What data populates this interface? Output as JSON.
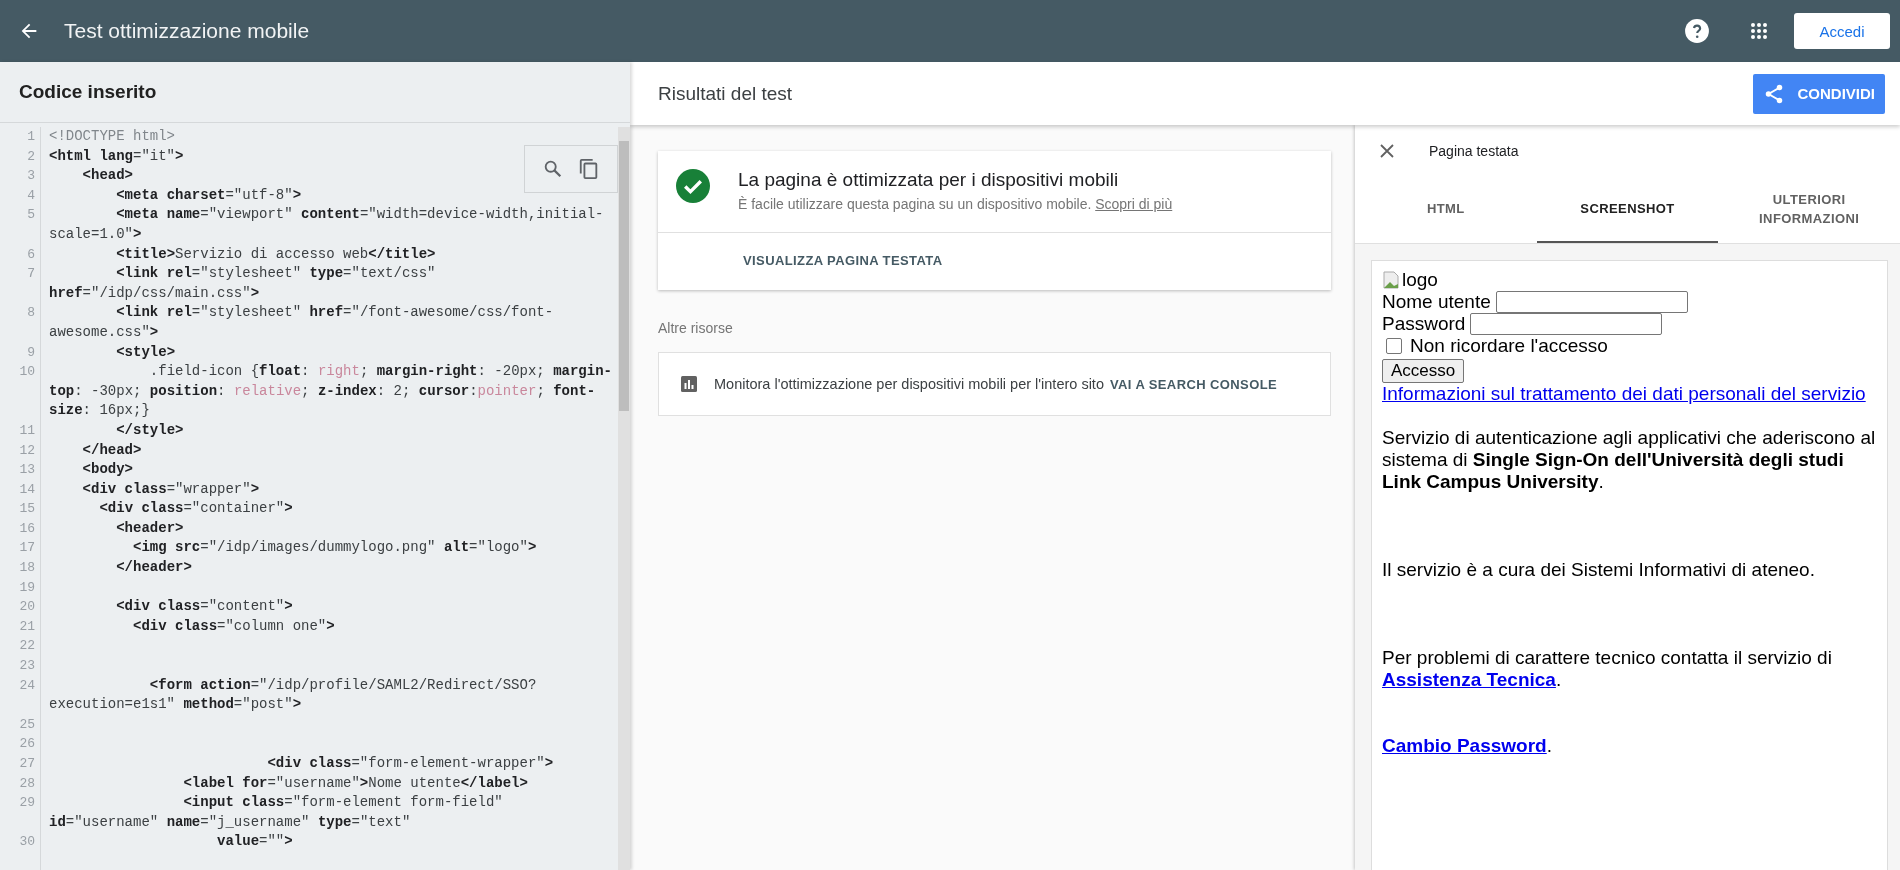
{
  "header": {
    "title": "Test ottimizzazione mobile",
    "sign_in": "Accedi"
  },
  "code_panel": {
    "title": "Codice inserito",
    "lines": [
      {
        "number": "1",
        "tokens": [
          {
            "kind": "doc",
            "text": "<!DOCTYPE html>"
          }
        ]
      },
      {
        "number": "2",
        "tokens": [
          {
            "kind": "tag",
            "text": "<html lang"
          },
          {
            "kind": "str",
            "text": "=\"it\""
          },
          {
            "kind": "tag",
            "text": ">"
          }
        ]
      },
      {
        "number": "3",
        "tokens": [
          {
            "kind": "tag",
            "text": "    <head>"
          }
        ]
      },
      {
        "number": "4",
        "tokens": [
          {
            "kind": "tag",
            "text": "        <meta charset"
          },
          {
            "kind": "str",
            "text": "=\"utf-8\""
          },
          {
            "kind": "tag",
            "text": ">"
          }
        ]
      },
      {
        "number": "5",
        "tokens": [
          {
            "kind": "tag",
            "text": "        <meta name"
          },
          {
            "kind": "str",
            "text": "=\"viewport\" "
          },
          {
            "kind": "tag",
            "text": "content"
          },
          {
            "kind": "str",
            "text": "=\"width=device-width,initial-scale=1.0\""
          },
          {
            "kind": "tag",
            "text": ">"
          }
        ]
      },
      {
        "number": "6",
        "tokens": [
          {
            "kind": "tag",
            "text": "        <title>"
          },
          {
            "kind": "str",
            "text": "Servizio di accesso web"
          },
          {
            "kind": "tag",
            "text": "</title>"
          }
        ]
      },
      {
        "number": "7",
        "tokens": [
          {
            "kind": "tag",
            "text": "        <link rel"
          },
          {
            "kind": "str",
            "text": "=\"stylesheet\" "
          },
          {
            "kind": "tag",
            "text": "type"
          },
          {
            "kind": "str",
            "text": "=\"text/css\" "
          },
          {
            "kind": "tag",
            "text": "href"
          },
          {
            "kind": "str",
            "text": "=\"/idp/css/main.css\""
          },
          {
            "kind": "tag",
            "text": ">"
          }
        ]
      },
      {
        "number": "8",
        "tokens": [
          {
            "kind": "tag",
            "text": "        <link rel"
          },
          {
            "kind": "str",
            "text": "=\"stylesheet\" "
          },
          {
            "kind": "tag",
            "text": "href"
          },
          {
            "kind": "str",
            "text": "=\"/font-awesome/css/font-awesome.css\""
          },
          {
            "kind": "tag",
            "text": ">"
          }
        ]
      },
      {
        "number": "9",
        "tokens": [
          {
            "kind": "tag",
            "text": "        <style>"
          }
        ]
      },
      {
        "number": "10",
        "tokens": [
          {
            "kind": "str",
            "text": "            .field-icon {"
          },
          {
            "kind": "tag",
            "text": "float"
          },
          {
            "kind": "str",
            "text": ": "
          },
          {
            "kind": "kw",
            "text": "right"
          },
          {
            "kind": "str",
            "text": "; "
          },
          {
            "kind": "tag",
            "text": "margin-right"
          },
          {
            "kind": "str",
            "text": ": -20px; "
          },
          {
            "kind": "tag",
            "text": "margin-top"
          },
          {
            "kind": "str",
            "text": ": -30px; "
          },
          {
            "kind": "tag",
            "text": "position"
          },
          {
            "kind": "str",
            "text": ": "
          },
          {
            "kind": "kw",
            "text": "relative"
          },
          {
            "kind": "str",
            "text": "; "
          },
          {
            "kind": "tag",
            "text": "z-index"
          },
          {
            "kind": "str",
            "text": ": 2; "
          },
          {
            "kind": "tag",
            "text": "cursor"
          },
          {
            "kind": "str",
            "text": ":"
          },
          {
            "kind": "kw",
            "text": "pointer"
          },
          {
            "kind": "str",
            "text": "; "
          },
          {
            "kind": "tag",
            "text": "font-size"
          },
          {
            "kind": "str",
            "text": ": 16px;}"
          }
        ]
      },
      {
        "number": "11",
        "tokens": [
          {
            "kind": "tag",
            "text": "        </style>"
          }
        ]
      },
      {
        "number": "12",
        "tokens": [
          {
            "kind": "tag",
            "text": "    </head>"
          }
        ]
      },
      {
        "number": "13",
        "tokens": [
          {
            "kind": "tag",
            "text": "    <body>"
          }
        ]
      },
      {
        "number": "14",
        "tokens": [
          {
            "kind": "tag",
            "text": "    <div class"
          },
          {
            "kind": "str",
            "text": "=\"wrapper\""
          },
          {
            "kind": "tag",
            "text": ">"
          }
        ]
      },
      {
        "number": "15",
        "tokens": [
          {
            "kind": "tag",
            "text": "      <div class"
          },
          {
            "kind": "str",
            "text": "=\"container\""
          },
          {
            "kind": "tag",
            "text": ">"
          }
        ]
      },
      {
        "number": "16",
        "tokens": [
          {
            "kind": "tag",
            "text": "        <header>"
          }
        ]
      },
      {
        "number": "17",
        "tokens": [
          {
            "kind": "tag",
            "text": "          <img src"
          },
          {
            "kind": "str",
            "text": "=\"/idp/images/dummylogo.png\" "
          },
          {
            "kind": "tag",
            "text": "alt"
          },
          {
            "kind": "str",
            "text": "=\"logo\""
          },
          {
            "kind": "tag",
            "text": ">"
          }
        ]
      },
      {
        "number": "18",
        "tokens": [
          {
            "kind": "tag",
            "text": "        </header>"
          }
        ]
      },
      {
        "number": "19"
      },
      {
        "number": "20",
        "tokens": [
          {
            "kind": "tag",
            "text": "        <div class"
          },
          {
            "kind": "str",
            "text": "=\"content\""
          },
          {
            "kind": "tag",
            "text": ">"
          }
        ]
      },
      {
        "number": "21",
        "tokens": [
          {
            "kind": "tag",
            "text": "          <div class"
          },
          {
            "kind": "str",
            "text": "=\"column one\""
          },
          {
            "kind": "tag",
            "text": ">"
          }
        ]
      },
      {
        "number": "22"
      },
      {
        "number": "23"
      },
      {
        "number": "24",
        "tokens": [
          {
            "kind": "tag",
            "text": "            <form action"
          },
          {
            "kind": "str",
            "text": "=\"/idp/profile/SAML2/Redirect/SSO?execution=e1s1\" "
          },
          {
            "kind": "tag",
            "text": "method"
          },
          {
            "kind": "str",
            "text": "=\"post\""
          },
          {
            "kind": "tag",
            "text": ">"
          }
        ]
      },
      {
        "number": "25"
      },
      {
        "number": "26"
      },
      {
        "number": "27",
        "tokens": [
          {
            "kind": "tag",
            "text": "                          <div class"
          },
          {
            "kind": "str",
            "text": "=\"form-element-wrapper\""
          },
          {
            "kind": "tag",
            "text": ">"
          }
        ]
      },
      {
        "number": "28",
        "tokens": [
          {
            "kind": "tag",
            "text": "                <label for"
          },
          {
            "kind": "str",
            "text": "=\"username\""
          },
          {
            "kind": "tag",
            "text": ">"
          },
          {
            "kind": "str",
            "text": "Nome utente"
          },
          {
            "kind": "tag",
            "text": "</label>"
          }
        ]
      },
      {
        "number": "29",
        "tokens": [
          {
            "kind": "tag",
            "text": "                <input class"
          },
          {
            "kind": "str",
            "text": "=\"form-element form-field\" "
          },
          {
            "kind": "tag",
            "text": "id"
          },
          {
            "kind": "str",
            "text": "=\"username\" "
          },
          {
            "kind": "tag",
            "text": "name"
          },
          {
            "kind": "str",
            "text": "=\"j_username\" "
          },
          {
            "kind": "tag",
            "text": "type"
          },
          {
            "kind": "str",
            "text": "=\"text\""
          }
        ]
      },
      {
        "number": "30",
        "tokens": [
          {
            "kind": "tag",
            "text": "                    value"
          },
          {
            "kind": "str",
            "text": "=\"\""
          },
          {
            "kind": "tag",
            "text": ">"
          }
        ]
      }
    ]
  },
  "results": {
    "title": "Risultati del test",
    "share": "CONDIVIDI",
    "verdict": {
      "title": "La pagina è ottimizzata per i dispositivi mobili",
      "text": "È facile utilizzare questa pagina su un dispositivo mobile.",
      "link": "Scopri di più",
      "action": "VISUALIZZA PAGINA TESTATA"
    },
    "resources_heading": "Altre risorse",
    "resource": {
      "text": "Monitora l'ottimizzazione per dispositivi mobili per l'intero sito",
      "link": "VAI A SEARCH CONSOLE"
    }
  },
  "tested_page": {
    "title": "Pagina testata",
    "tabs": [
      {
        "label": "HTML",
        "selected": false
      },
      {
        "label": "SCREENSHOT",
        "selected": true
      },
      {
        "label": "ULTERIORI INFORMAZIONI",
        "selected": false
      }
    ],
    "screenshot": {
      "logo_alt": "logo",
      "fields": [
        {
          "label": "Nome utente"
        },
        {
          "label": "Password"
        }
      ],
      "checkbox": {
        "label": "Non ricordare l'accesso",
        "checked": false
      },
      "button": "Accesso",
      "privacy_link": "Informazioni sul trattamento dei dati personali del servizio",
      "intro": "Servizio di autenticazione agli applicativi che aderiscono al sistema di **Single Sign-On dell'Università degli studi Link Campus University**.",
      "note": "Il servizio è a cura dei Sistemi Informativi di ateneo.",
      "support": {
        "text": "Per problemi di carattere tecnico contatta il servizio di",
        "link": "Assistenza Tecnica",
        "after": "."
      },
      "password": {
        "link": "Cambio Password",
        "after": "."
      }
    }
  }
}
